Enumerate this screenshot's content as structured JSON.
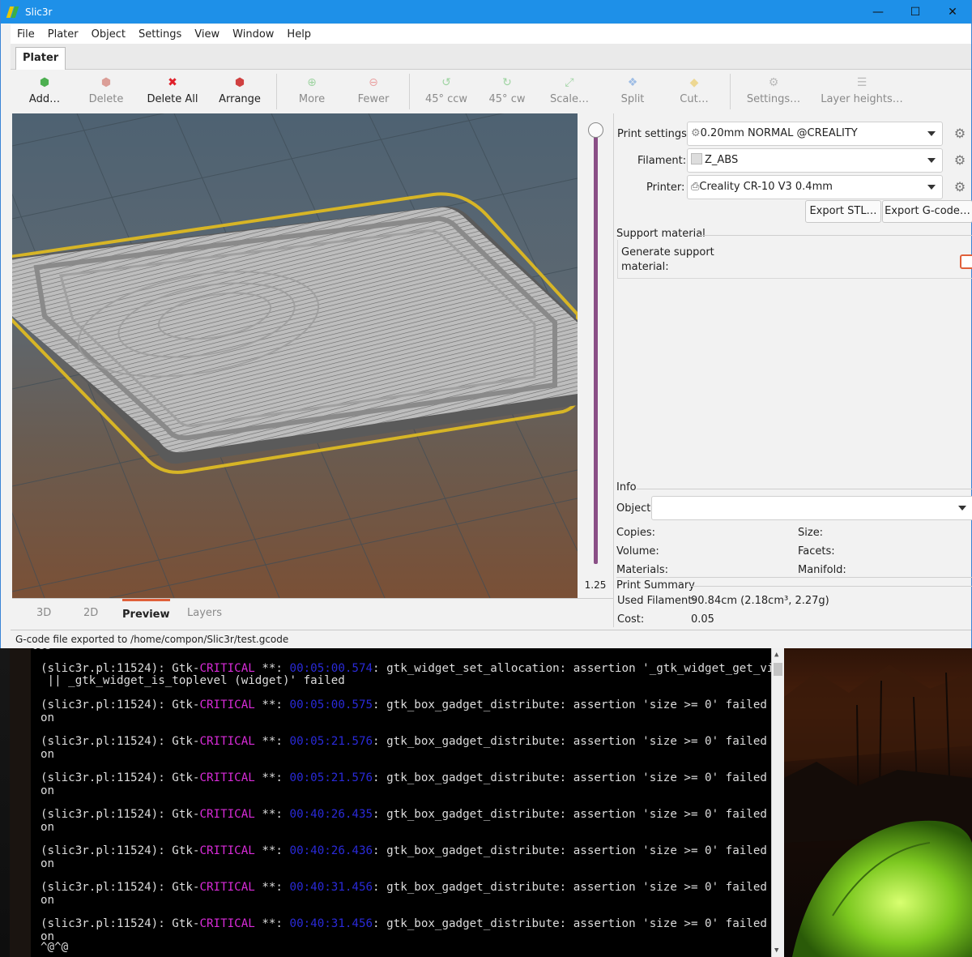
{
  "window": {
    "title": "Slic3r",
    "controls": [
      "minimize-icon",
      "maximize-icon",
      "close-icon"
    ]
  },
  "menu": [
    "File",
    "Plater",
    "Object",
    "Settings",
    "View",
    "Window",
    "Help"
  ],
  "main_tab": "Plater",
  "toolbar": [
    {
      "label": "Add…",
      "icon": "add-icon",
      "enabled": true
    },
    {
      "label": "Delete",
      "icon": "delete-icon",
      "enabled": false
    },
    {
      "label": "Delete All",
      "icon": "delete-all-icon",
      "enabled": true
    },
    {
      "label": "Arrange",
      "icon": "arrange-icon",
      "enabled": true
    },
    {
      "label": "More",
      "icon": "more-icon",
      "enabled": false
    },
    {
      "label": "Fewer",
      "icon": "fewer-icon",
      "enabled": false
    },
    {
      "label": "45° ccw",
      "icon": "rotate-ccw-icon",
      "enabled": false
    },
    {
      "label": "45° cw",
      "icon": "rotate-cw-icon",
      "enabled": false
    },
    {
      "label": "Scale…",
      "icon": "scale-icon",
      "enabled": false
    },
    {
      "label": "Split",
      "icon": "split-icon",
      "enabled": false
    },
    {
      "label": "Cut…",
      "icon": "cut-icon",
      "enabled": false
    },
    {
      "label": "Settings…",
      "icon": "settings-icon",
      "enabled": false
    },
    {
      "label": "Layer heights…",
      "icon": "layer-heights-icon",
      "enabled": false
    }
  ],
  "layer_slider": {
    "value": "1.25"
  },
  "view_tabs": [
    "3D",
    "2D",
    "Preview",
    "Layers"
  ],
  "active_view_tab": "Preview",
  "presets": {
    "print_label": "Print settings:",
    "print_value": "0.20mm NORMAL @CREALITY",
    "filament_label": "Filament:",
    "filament_value": "Z_ABS",
    "printer_label": "Printer:",
    "printer_value": "Creality CR-10 V3 0.4mm"
  },
  "export": {
    "stl": "Export STL…",
    "gcode": "Export G-code…"
  },
  "support": {
    "title": "Support material",
    "generate_label": "Generate support material:",
    "generate_checked": false
  },
  "info": {
    "title": "Info",
    "object_label": "Object:",
    "object_value": "",
    "copies_label": "Copies:",
    "size_label": "Size:",
    "volume_label": "Volume:",
    "facets_label": "Facets:",
    "materials_label": "Materials:",
    "manifold_label": "Manifold:"
  },
  "summary": {
    "title": "Print Summary",
    "filament_label": "Used Filament:",
    "filament_value": "90.84cm (2.18cm³, 2.27g)",
    "cost_label": "Cost:",
    "cost_value": "0.05"
  },
  "status": "G-code file exported to /home/compon/Slic3r/test.gcode",
  "terminal": {
    "top_partial": "tes",
    "line1": {
      "prefix": "(slic3r.pl:11524): Gtk-",
      "level": "CRITICAL",
      "sep": " **: ",
      "ts": "00:05:00.574",
      "msg": ": gtk_widget_set_allocation: assertion '_gtk_widget_get_visible (widget)"
    },
    "line1_cont": " || _gtk_widget_is_toplevel (widget)' failed",
    "entries": [
      {
        "prefix": "(slic3r.pl:11524): Gtk-",
        "level": "CRITICAL",
        "sep": " **: ",
        "ts": "00:05:00.575",
        "msg": ": gtk_box_gadget_distribute: assertion 'size >= 0' failed in GtkSpinButt",
        "cont": "on"
      },
      {
        "prefix": "(slic3r.pl:11524): Gtk-",
        "level": "CRITICAL",
        "sep": " **: ",
        "ts": "00:05:21.576",
        "msg": ": gtk_box_gadget_distribute: assertion 'size >= 0' failed in GtkSpinButt",
        "cont": "on"
      },
      {
        "prefix": "(slic3r.pl:11524): Gtk-",
        "level": "CRITICAL",
        "sep": " **: ",
        "ts": "00:05:21.576",
        "msg": ": gtk_box_gadget_distribute: assertion 'size >= 0' failed in GtkSpinButt",
        "cont": "on"
      },
      {
        "prefix": "(slic3r.pl:11524): Gtk-",
        "level": "CRITICAL",
        "sep": " **: ",
        "ts": "00:40:26.435",
        "msg": ": gtk_box_gadget_distribute: assertion 'size >= 0' failed in GtkSpinButt",
        "cont": "on"
      },
      {
        "prefix": "(slic3r.pl:11524): Gtk-",
        "level": "CRITICAL",
        "sep": " **: ",
        "ts": "00:40:26.436",
        "msg": ": gtk_box_gadget_distribute: assertion 'size >= 0' failed in GtkSpinButt",
        "cont": "on"
      },
      {
        "prefix": "(slic3r.pl:11524): Gtk-",
        "level": "CRITICAL",
        "sep": " **: ",
        "ts": "00:40:31.456",
        "msg": ": gtk_box_gadget_distribute: assertion 'size >= 0' failed in GtkSpinButt",
        "cont": "on"
      },
      {
        "prefix": "(slic3r.pl:11524): Gtk-",
        "level": "CRITICAL",
        "sep": " **: ",
        "ts": "00:40:31.456",
        "msg": ": gtk_box_gadget_distribute: assertion 'size >= 0' failed in GtkSpinButt",
        "cont": "on"
      }
    ],
    "last": "^@^@"
  },
  "colors": {
    "titlebar": "#1e90e8",
    "accent": "#e0603a",
    "slider": "#8a4f86",
    "skirt": "#d7b526",
    "critical": "#d82bd8",
    "timestamp": "#2a2ad8"
  }
}
